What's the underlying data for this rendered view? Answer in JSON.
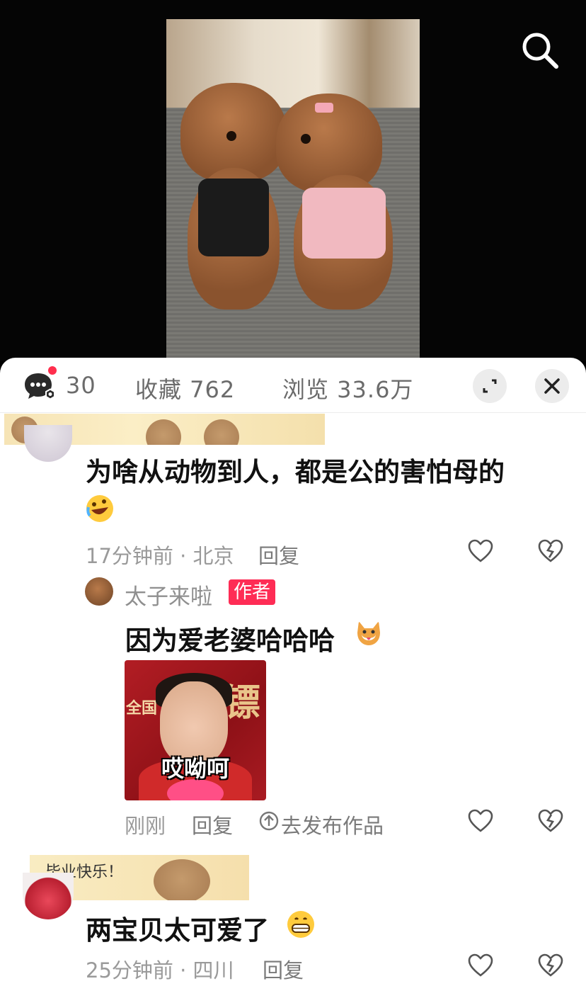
{
  "stats": {
    "partial_count": "30",
    "favorites": "收藏 762",
    "views": "浏览 33.6万"
  },
  "comments": [
    {
      "text": "为啥从动物到人，都是公的害怕母的",
      "emoji": "rolling-laughing-emoji",
      "time_location": "17分钟前 · 北京",
      "reply_label": "回复"
    },
    {
      "author": "太子来啦",
      "badge": "作者",
      "text": "因为爱老婆哈哈哈",
      "emoji": "dog-face-emoji",
      "sticker": {
        "caption": "哎呦呵",
        "side_text": "全国",
        "big_char": "镖"
      },
      "time": "刚刚",
      "reply_label": "回复",
      "publish_label": "去发布作品"
    },
    {
      "text": "两宝贝太可爱了",
      "emoji": "grinning-emoji",
      "banner_text": "毕业快乐！",
      "time_location": "25分钟前 · 四川",
      "reply_label": "回复"
    }
  ],
  "colors": {
    "author_badge": "#fe2c55",
    "notification_dot": "#ff2e4d"
  }
}
